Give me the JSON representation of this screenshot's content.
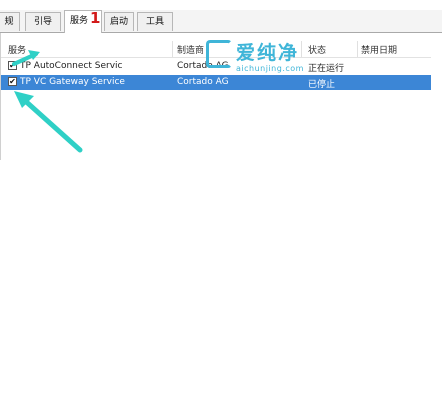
{
  "tabs": [
    {
      "label": "规",
      "active": false
    },
    {
      "label": "引导",
      "active": false
    },
    {
      "label": "服务",
      "active": true
    },
    {
      "label": "启动",
      "active": false
    },
    {
      "label": "工具",
      "active": false
    }
  ],
  "step_badge": "1",
  "table": {
    "columns": [
      "服务",
      "制造商",
      "状态",
      "禁用日期"
    ],
    "rows": [
      {
        "checked": true,
        "service": "TP AutoConnect Servic",
        "manufacturer": "Cortado AG",
        "status": "正在运行",
        "disabled_date": "",
        "selected": false
      },
      {
        "checked": true,
        "service": "TP VC Gateway Service",
        "manufacturer": "Cortado AG",
        "status": "已停止",
        "disabled_date": "",
        "selected": true
      }
    ]
  },
  "watermark": {
    "brand": "爱纯净",
    "site": "aichunjing.com"
  },
  "colors": {
    "selection": "#3c86d6",
    "arrow": "#2fd0c6",
    "badge": "#d21a1a",
    "watermark": "#3fb5d8"
  },
  "icons": [
    "checkbox-icon",
    "arrow-annotation",
    "watermark-logo-icon"
  ]
}
